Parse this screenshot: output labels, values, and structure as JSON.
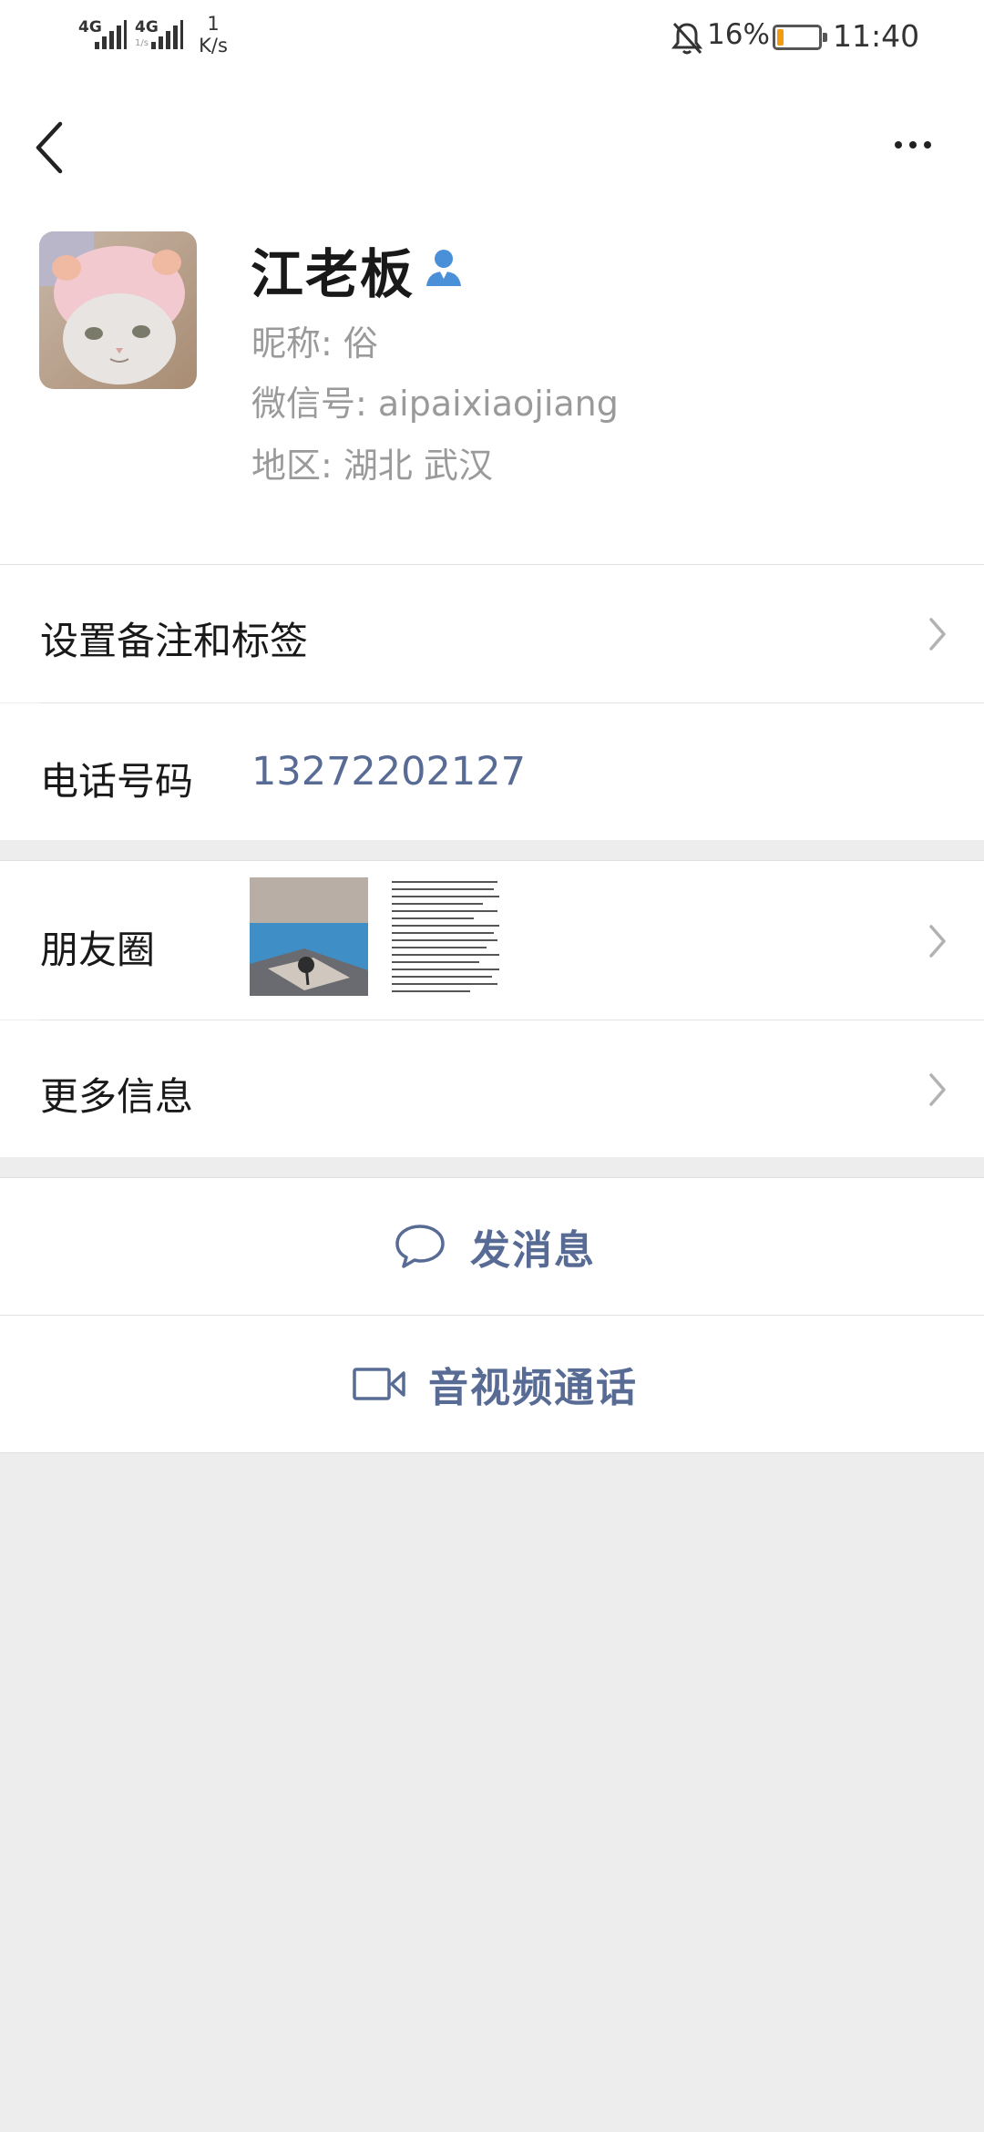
{
  "status_bar": {
    "net1": "4G",
    "net2": "4G",
    "net2_sub": "1/s",
    "speed_value": "1",
    "speed_unit": "K/s",
    "battery_pct": "16%",
    "battery_level": 0.16,
    "time": "11:40"
  },
  "profile": {
    "name": "江老板",
    "nickname": "昵称: 俗",
    "wechat_id": "微信号: aipaixiaojiang",
    "region": "地区: 湖北  武汉"
  },
  "rows": {
    "remark_label": "设置备注和标签",
    "phone_label": "电话号码",
    "phone_value": "13272202127",
    "moments_label": "朋友圈",
    "more_info_label": "更多信息"
  },
  "actions": {
    "send_message": "发消息",
    "video_call": "音视频通话"
  },
  "colors": {
    "link_blue": "#576b95",
    "battery": "#f39c12",
    "badge_blue": "#4a90d9"
  },
  "icons": [
    "back-icon",
    "more-icon",
    "person-badge-icon",
    "chevron-right-icon",
    "chat-bubble-icon",
    "video-camera-icon",
    "bell-off-icon",
    "battery-icon",
    "signal-icon"
  ]
}
